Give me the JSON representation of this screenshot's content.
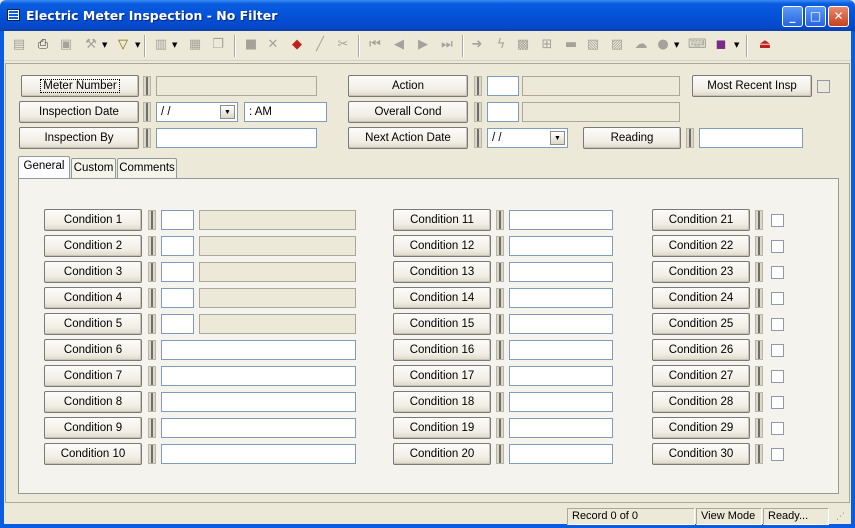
{
  "window": {
    "title": "Electric Meter Inspection - No Filter"
  },
  "title_buttons": {
    "minimize": "_",
    "maximize": "□",
    "close": "✕"
  },
  "header": {
    "meter_number": {
      "label": "Meter Number",
      "value": ""
    },
    "inspection_date": {
      "label": "Inspection Date",
      "date": " /  /",
      "time": " :  AM"
    },
    "inspection_by": {
      "label": "Inspection By",
      "value": ""
    },
    "action": {
      "label": "Action",
      "code": "",
      "desc": ""
    },
    "overall_cond": {
      "label": "Overall Cond",
      "code": "",
      "desc": ""
    },
    "next_action_date": {
      "label": "Next Action Date",
      "date": " /  /"
    },
    "most_recent_insp": {
      "label": "Most Recent Insp"
    },
    "reading": {
      "label": "Reading",
      "value": ""
    }
  },
  "tabs": [
    "General",
    "Custom",
    "Comments"
  ],
  "conditions": {
    "col1": [
      "Condition 1",
      "Condition 2",
      "Condition 3",
      "Condition 4",
      "Condition 5",
      "Condition 6",
      "Condition 7",
      "Condition 8",
      "Condition 9",
      "Condition 10"
    ],
    "col2": [
      "Condition 11",
      "Condition 12",
      "Condition 13",
      "Condition 14",
      "Condition 15",
      "Condition 16",
      "Condition 17",
      "Condition 18",
      "Condition 19",
      "Condition 20"
    ],
    "col3": [
      "Condition 21",
      "Condition 22",
      "Condition 23",
      "Condition 24",
      "Condition 25",
      "Condition 26",
      "Condition 27",
      "Condition 28",
      "Condition 29",
      "Condition 30"
    ]
  },
  "status": {
    "record": "Record 0 of 0",
    "mode": "View Mode",
    "state": "Ready..."
  },
  "toolbar_icons": [
    "new-icon",
    "print-icon",
    "preview-icon",
    "tools-icon",
    "filter-icon",
    "report-icon",
    "edit-icon",
    "copy-icon",
    "save-icon",
    "delete-icon",
    "stamp-icon",
    "pencil-icon",
    "cut-icon",
    "first-icon",
    "prev-icon",
    "next-icon",
    "last-icon",
    "goto-icon",
    "lightning-icon",
    "tree-icon",
    "link-icon",
    "grid-icon",
    "calendar-icon",
    "map-icon",
    "cloud-icon",
    "chat-icon",
    "keyboard-icon",
    "book-icon",
    "exit-icon"
  ],
  "colors": {
    "titlebar": "#0452d7",
    "face": "#ece9d8",
    "close": "#c6411f"
  }
}
